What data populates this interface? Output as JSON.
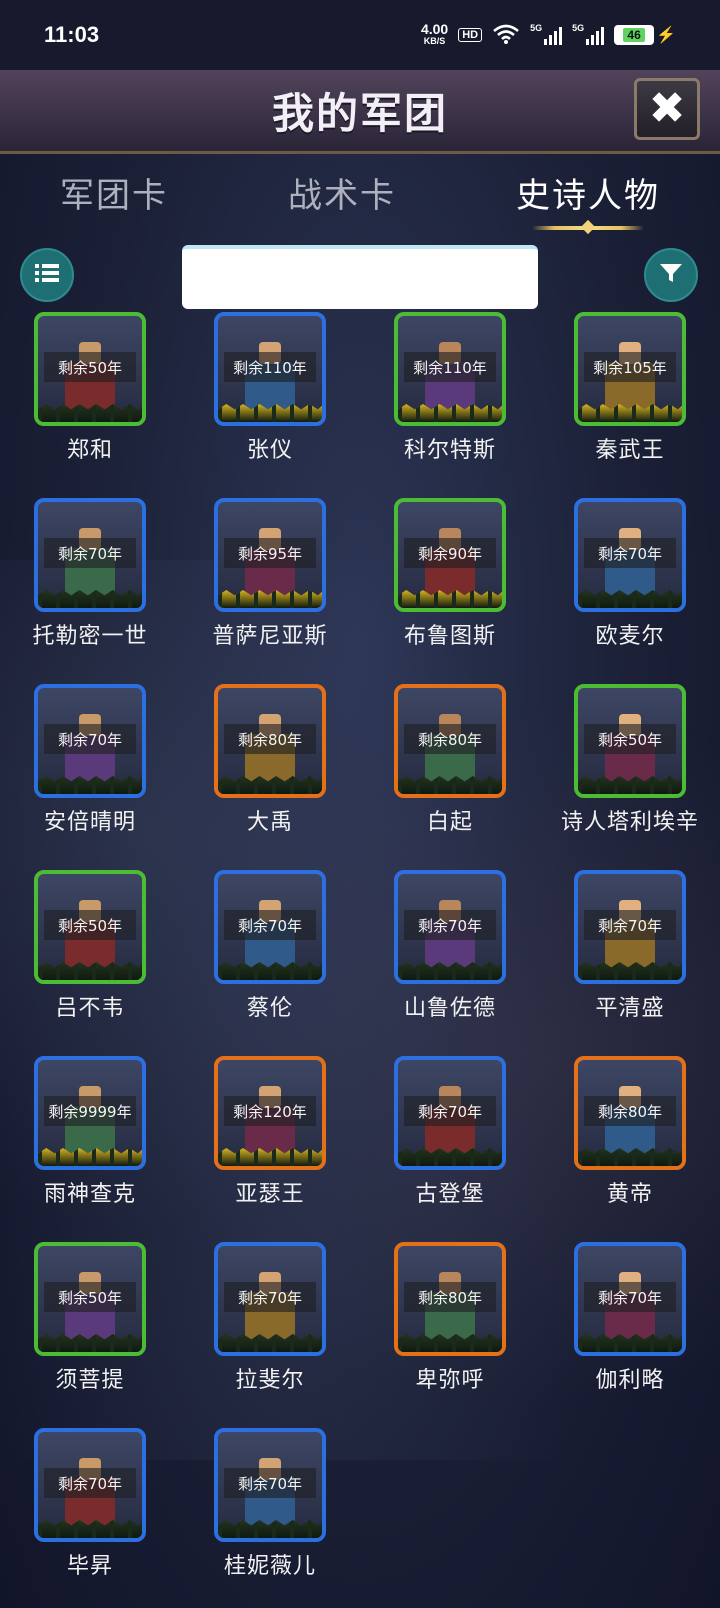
{
  "status": {
    "time": "11:03",
    "net_speed": "4.00",
    "net_unit": "KB/S",
    "hd": "HD",
    "sim1": "5G",
    "sim2": "5G",
    "battery": "46"
  },
  "header": {
    "title": "我的军团",
    "close_icon": "close-icon"
  },
  "tabs": [
    {
      "label": "军团卡",
      "active": false
    },
    {
      "label": "战术卡",
      "active": false
    },
    {
      "label": "史诗人物",
      "active": true
    }
  ],
  "search": {
    "value": "",
    "placeholder": ""
  },
  "colors": {
    "green": "#4cbc35",
    "blue": "#2c6fe0",
    "orange": "#e4701a",
    "teal": "#1d6f73"
  },
  "cards": [
    {
      "name": "郑和",
      "remain": "剩余50年",
      "rarity": "green",
      "gold": false
    },
    {
      "name": "张仪",
      "remain": "剩余110年",
      "rarity": "blue",
      "gold": true
    },
    {
      "name": "科尔特斯",
      "remain": "剩余110年",
      "rarity": "green",
      "gold": true
    },
    {
      "name": "秦武王",
      "remain": "剩余105年",
      "rarity": "green",
      "gold": true
    },
    {
      "name": "托勒密一世",
      "remain": "剩余70年",
      "rarity": "blue",
      "gold": false
    },
    {
      "name": "普萨尼亚斯",
      "remain": "剩余95年",
      "rarity": "blue",
      "gold": true
    },
    {
      "name": "布鲁图斯",
      "remain": "剩余90年",
      "rarity": "green",
      "gold": true
    },
    {
      "name": "欧麦尔",
      "remain": "剩余70年",
      "rarity": "blue",
      "gold": false
    },
    {
      "name": "安倍晴明",
      "remain": "剩余70年",
      "rarity": "blue",
      "gold": false
    },
    {
      "name": "大禹",
      "remain": "剩余80年",
      "rarity": "orange",
      "gold": false
    },
    {
      "name": "白起",
      "remain": "剩余80年",
      "rarity": "orange",
      "gold": false
    },
    {
      "name": "诗人塔利埃辛",
      "remain": "剩余50年",
      "rarity": "green",
      "gold": false
    },
    {
      "name": "吕不韦",
      "remain": "剩余50年",
      "rarity": "green",
      "gold": false
    },
    {
      "name": "蔡伦",
      "remain": "剩余70年",
      "rarity": "blue",
      "gold": false
    },
    {
      "name": "山鲁佐德",
      "remain": "剩余70年",
      "rarity": "blue",
      "gold": false
    },
    {
      "name": "平清盛",
      "remain": "剩余70年",
      "rarity": "blue",
      "gold": false
    },
    {
      "name": "雨神查克",
      "remain": "剩余9999年",
      "rarity": "blue",
      "gold": true
    },
    {
      "name": "亚瑟王",
      "remain": "剩余120年",
      "rarity": "orange",
      "gold": true
    },
    {
      "name": "古登堡",
      "remain": "剩余70年",
      "rarity": "blue",
      "gold": false
    },
    {
      "name": "黄帝",
      "remain": "剩余80年",
      "rarity": "orange",
      "gold": false
    },
    {
      "name": "须菩提",
      "remain": "剩余50年",
      "rarity": "green",
      "gold": false
    },
    {
      "name": "拉斐尔",
      "remain": "剩余70年",
      "rarity": "blue",
      "gold": false
    },
    {
      "name": "卑弥呼",
      "remain": "剩余80年",
      "rarity": "orange",
      "gold": false
    },
    {
      "name": "伽利略",
      "remain": "剩余70年",
      "rarity": "blue",
      "gold": false
    },
    {
      "name": "毕昇",
      "remain": "剩余70年",
      "rarity": "blue",
      "gold": false
    },
    {
      "name": "桂妮薇儿",
      "remain": "剩余70年",
      "rarity": "blue",
      "gold": false
    }
  ]
}
